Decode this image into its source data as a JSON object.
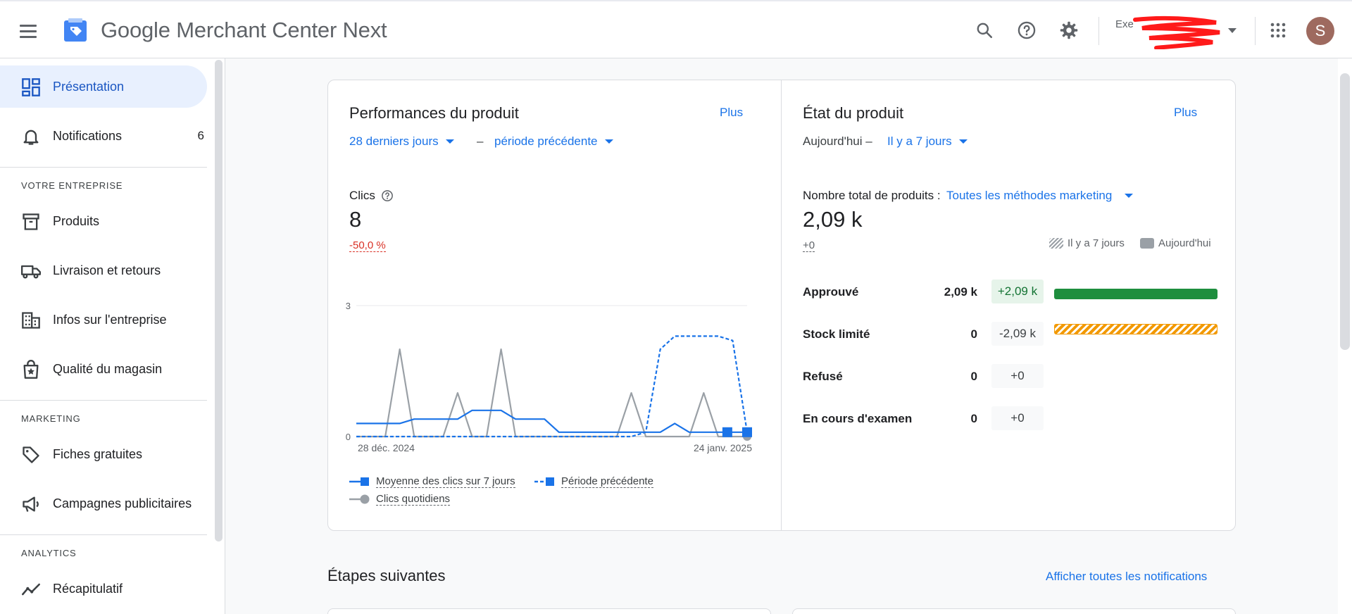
{
  "header": {
    "brand_google": "Google",
    "brand_product": "Merchant Center Next",
    "account_name": "Exe",
    "avatar_letter": "S"
  },
  "sidebar": {
    "items": [
      {
        "label": "Présentation",
        "icon": "dashboard-icon",
        "active": true
      },
      {
        "label": "Notifications",
        "icon": "bell-icon",
        "count": "6"
      }
    ],
    "sections": [
      {
        "title": "VOTRE ENTREPRISE",
        "items": [
          {
            "label": "Produits",
            "icon": "archive-icon"
          },
          {
            "label": "Livraison et retours",
            "icon": "truck-icon"
          },
          {
            "label": "Infos sur l'entreprise",
            "icon": "building-icon"
          },
          {
            "label": "Qualité du magasin",
            "icon": "store-quality-icon"
          }
        ]
      },
      {
        "title": "MARKETING",
        "items": [
          {
            "label": "Fiches gratuites",
            "icon": "tag-icon"
          },
          {
            "label": "Campagnes publicitaires",
            "icon": "megaphone-icon"
          }
        ]
      },
      {
        "title": "ANALYTICS",
        "items": [
          {
            "label": "Récapitulatif",
            "icon": "trend-icon"
          }
        ]
      }
    ]
  },
  "performance": {
    "title": "Performances du produit",
    "more": "Plus",
    "period": "28 derniers jours",
    "separator": "–",
    "compare": "période précédente",
    "metric_label": "Clics",
    "metric_value": "8",
    "metric_change": "-50,0 %",
    "legend": {
      "avg": "Moyenne des clics sur 7 jours",
      "prev": "Période précédente",
      "daily": "Clics quotidiens"
    }
  },
  "product_state": {
    "title": "État du produit",
    "more": "Plus",
    "today": "Aujourd'hui –",
    "compare": "Il y a 7 jours",
    "total_label": "Nombre total de produits :",
    "total_filter": "Toutes les méthodes marketing",
    "total_value": "2,09 k",
    "total_change": "+0",
    "legend_prev": "Il y a 7 jours",
    "legend_today": "Aujourd'hui",
    "rows": [
      {
        "label": "Approuvé",
        "value": "2,09 k",
        "change": "+2,09 k",
        "bar_fraction": 1.0,
        "bar_style": "solid",
        "color": "#1e8e3e"
      },
      {
        "label": "Stock limité",
        "value": "0",
        "change": "-2,09 k",
        "bar_fraction": 1.0,
        "bar_style": "hatch",
        "color": "#f29900"
      },
      {
        "label": "Refusé",
        "value": "0",
        "change": "+0",
        "bar_fraction": 0
      },
      {
        "label": "En cours d'examen",
        "value": "0",
        "change": "+0",
        "bar_fraction": 0
      }
    ]
  },
  "next_steps": {
    "title": "Étapes suivantes",
    "all_link": "Afficher toutes les notifications"
  },
  "chart_data": {
    "type": "line",
    "title": "",
    "x_tick_labels": [
      "28 déc. 2024",
      "24 janv. 2025"
    ],
    "ylim": [
      0,
      3
    ],
    "y_ticks": [
      "0",
      "3"
    ],
    "x": [
      1,
      2,
      3,
      4,
      5,
      6,
      7,
      8,
      9,
      10,
      11,
      12,
      13,
      14,
      15,
      16,
      17,
      18,
      19,
      20,
      21,
      22,
      23,
      24,
      25,
      26,
      27,
      28
    ],
    "series": [
      {
        "name": "Moyenne des clics sur 7 jours",
        "style": "solid",
        "color": "#1a73e8",
        "values": [
          0.3,
          0.3,
          0.3,
          0.3,
          0.4,
          0.4,
          0.4,
          0.4,
          0.6,
          0.6,
          0.6,
          0.4,
          0.4,
          0.4,
          0.1,
          0.1,
          0.1,
          0.1,
          0.1,
          0.1,
          0.1,
          0.1,
          0.3,
          0.1,
          0.1,
          0.1,
          0.1,
          0.1
        ]
      },
      {
        "name": "Période précédente",
        "style": "dashed",
        "color": "#1a73e8",
        "values": [
          0,
          0,
          0,
          0,
          0,
          0,
          0,
          0,
          0,
          0,
          0,
          0,
          0,
          0,
          0,
          0,
          0,
          0,
          0,
          0,
          0.1,
          2.0,
          2.3,
          2.3,
          2.3,
          2.3,
          2.2,
          0.1
        ]
      },
      {
        "name": "Clics quotidiens",
        "style": "solid",
        "color": "#9aa0a6",
        "values": [
          0,
          0,
          0,
          2,
          0,
          0,
          0,
          1,
          0,
          0,
          2,
          0,
          0,
          0,
          0,
          0,
          0,
          0,
          0,
          1,
          0,
          0,
          0,
          0,
          1,
          0,
          0,
          0
        ]
      }
    ]
  }
}
